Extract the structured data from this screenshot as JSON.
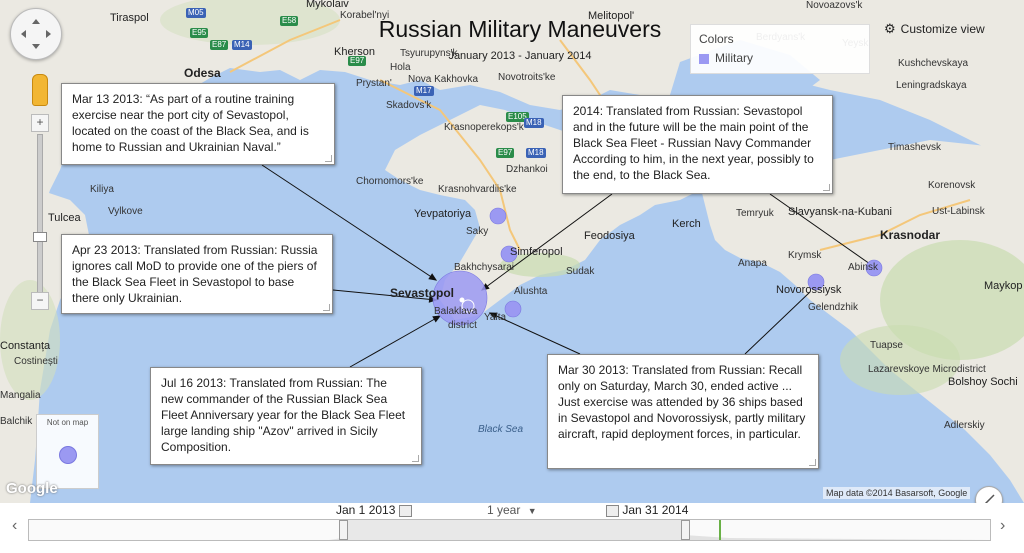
{
  "header": {
    "title": "Russian Military Maneuvers",
    "subtitle": "January 2013 - January 2014",
    "customize_label": "Customize view"
  },
  "legend": {
    "title": "Colors",
    "items": [
      {
        "label": "Military",
        "color": "#9b99f2"
      }
    ]
  },
  "map": {
    "colors": {
      "sea": "#aecbef",
      "land": "#ebe9e2",
      "bubble": "#9b99f2",
      "bubble_edge": "#7a78e0"
    },
    "places": [
      {
        "name": "Mykolaiv",
        "kind": "city"
      },
      {
        "name": "Korabel'nyi",
        "kind": "town"
      },
      {
        "name": "district",
        "kind": "town"
      },
      {
        "name": "Tiraspol",
        "kind": "city"
      },
      {
        "name": "Odesa",
        "kind": "big"
      },
      {
        "name": "Kherson",
        "kind": "city"
      },
      {
        "name": "Tsyurupyns'k",
        "kind": "town"
      },
      {
        "name": "Hola",
        "kind": "town"
      },
      {
        "name": "Prystan'",
        "kind": "town"
      },
      {
        "name": "Nova Kakhovka",
        "kind": "town"
      },
      {
        "name": "Melitopol'",
        "kind": "city"
      },
      {
        "name": "Novotroits'ke",
        "kind": "town"
      },
      {
        "name": "Skadovs'k",
        "kind": "town"
      },
      {
        "name": "Krasnoperekops'k",
        "kind": "town"
      },
      {
        "name": "Chornomors'ke",
        "kind": "town"
      },
      {
        "name": "Krasnohvardiis'ke",
        "kind": "town"
      },
      {
        "name": "Dzhankoi",
        "kind": "town"
      },
      {
        "name": "Yevpatoriya",
        "kind": "city"
      },
      {
        "name": "Saky",
        "kind": "town"
      },
      {
        "name": "Simferopol",
        "kind": "city"
      },
      {
        "name": "Bakhchysarai",
        "kind": "town"
      },
      {
        "name": "Sevastopol",
        "kind": "big"
      },
      {
        "name": "Balaklava",
        "kind": "town"
      },
      {
        "name": "Yalta",
        "kind": "town"
      },
      {
        "name": "Alushta",
        "kind": "town"
      },
      {
        "name": "Sudak",
        "kind": "town"
      },
      {
        "name": "Feodosiya",
        "kind": "city"
      },
      {
        "name": "Kerch",
        "kind": "city"
      },
      {
        "name": "Temryuk",
        "kind": "town"
      },
      {
        "name": "Slavyansk-na-Kubani",
        "kind": "city"
      },
      {
        "name": "Krasnodar",
        "kind": "big"
      },
      {
        "name": "Abinsk",
        "kind": "town"
      },
      {
        "name": "Krymsk",
        "kind": "town"
      },
      {
        "name": "Anapa",
        "kind": "town"
      },
      {
        "name": "Novorossiysk",
        "kind": "city"
      },
      {
        "name": "Gelendzhik",
        "kind": "town"
      },
      {
        "name": "Tuapse",
        "kind": "town"
      },
      {
        "name": "Lazarevskoye Microdistrict",
        "kind": "town"
      },
      {
        "name": "Bolshoy Sochi",
        "kind": "city"
      },
      {
        "name": "Adlerskiy",
        "kind": "town"
      },
      {
        "name": "Ust-Labinsk",
        "kind": "town"
      },
      {
        "name": "Korenovsk",
        "kind": "town"
      },
      {
        "name": "Timashevsk",
        "kind": "town"
      },
      {
        "name": "Leningradskaya",
        "kind": "town"
      },
      {
        "name": "Kushchevskaya",
        "kind": "town"
      },
      {
        "name": "Yeysk",
        "kind": "town"
      },
      {
        "name": "Novoazovs'k",
        "kind": "town"
      },
      {
        "name": "Berdyans'k",
        "kind": "town"
      },
      {
        "name": "Maykop",
        "kind": "city"
      },
      {
        "name": "Kiliya",
        "kind": "town"
      },
      {
        "name": "Vylkove",
        "kind": "town"
      },
      {
        "name": "Tulcea",
        "kind": "city"
      },
      {
        "name": "Constanța",
        "kind": "city"
      },
      {
        "name": "Costinești",
        "kind": "town"
      },
      {
        "name": "Mangalia",
        "kind": "town"
      },
      {
        "name": "Balchik",
        "kind": "town"
      },
      {
        "name": "Black Sea",
        "kind": "sea"
      }
    ],
    "roads": [
      {
        "label": "M05",
        "color": "blue"
      },
      {
        "label": "E95",
        "color": "green"
      },
      {
        "label": "E58",
        "color": "green"
      },
      {
        "label": "E87",
        "color": "green"
      },
      {
        "label": "M14",
        "color": "blue"
      },
      {
        "label": "E97",
        "color": "green"
      },
      {
        "label": "M17",
        "color": "blue"
      },
      {
        "label": "E105",
        "color": "green"
      },
      {
        "label": "M18",
        "color": "blue"
      },
      {
        "label": "E97",
        "color": "green"
      },
      {
        "label": "M18",
        "color": "blue"
      }
    ]
  },
  "callouts": [
    {
      "text": "Mar 13 2013: “As part of a routine training exercise near the port city of Sevastopol, located on the coast of the Black Sea, and is home to Russian and Ukrainian Naval.”"
    },
    {
      "text": "2014: Translated from Russian: Sevastopol and in the future will be the main point of the Black Sea Fleet - Russian Navy Commander According to him, in the next year, possibly to the end, to the Black Sea."
    },
    {
      "text": "Apr 23 2013: Translated from Russian: Russia ignores call MoD to provide one of the piers of the Black Sea Fleet in Sevastopol to base there only Ukrainian."
    },
    {
      "text": "Jul 16 2013: Translated from Russian: The new commander of the Russian Black Sea Fleet Anniversary year for the Black Sea Fleet large landing ship \"Azov\" arrived in Sicily Composition."
    },
    {
      "text": "Mar 30 2013: Translated from Russian: Recall only on Saturday, March 30, ended active ... Just exercise was attended by 36 ships based in Sevastopol and Novorossiysk, partly military aircraft, rapid deployment forces, in particular."
    }
  ],
  "controls": {
    "not_on_map_label": "Not on map",
    "zoom_in": "+",
    "zoom_out": "−",
    "attribution": "Map data ©2014 Basarsoft, Google",
    "google_logo": "Google"
  },
  "timeline": {
    "start_label": "Jan 1 2013",
    "end_label": "Jan 31 2014",
    "zoom_label": "1 year",
    "prev_arrow": "‹",
    "next_arrow": "›"
  }
}
